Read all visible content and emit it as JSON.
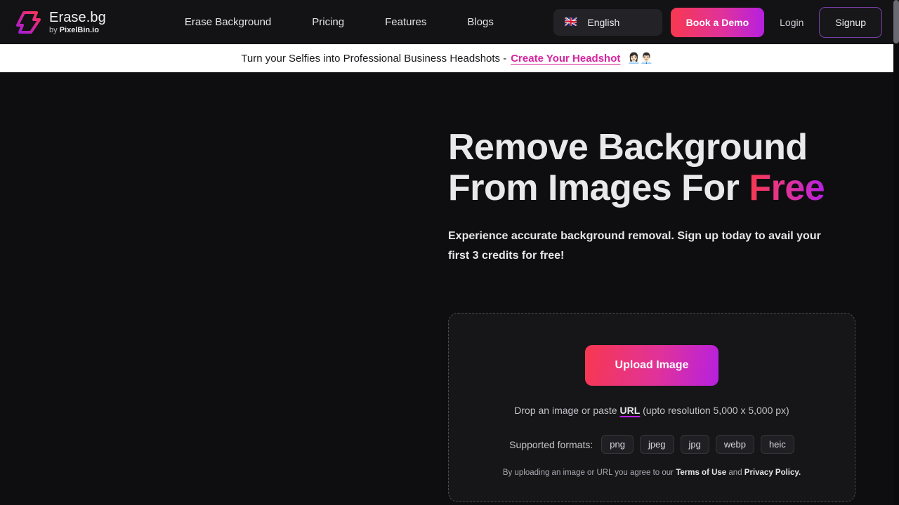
{
  "header": {
    "brand": {
      "name": "Erase.bg",
      "by_prefix": "by ",
      "by_name": "PixelBin.io",
      "logo_icon": "diamond-logo-icon"
    },
    "nav": [
      {
        "label": "Erase Background"
      },
      {
        "label": "Pricing"
      },
      {
        "label": "Features"
      },
      {
        "label": "Blogs"
      }
    ],
    "language": {
      "flag_icon": "uk-flag-icon",
      "flag_glyph": "🇬🇧",
      "label": "English"
    },
    "demo_button": "Book a Demo",
    "login_button": "Login",
    "signup_button": "Signup"
  },
  "banner": {
    "text": "Turn your Selfies into Professional Business Headshots -",
    "link": "Create Your Headshot",
    "emoji": "👩🏻‍💼👨🏻‍💼"
  },
  "hero": {
    "title_line1": "Remove Background",
    "title_line2_plain": "From Images For ",
    "title_line2_accent": "Free",
    "subtitle": "Experience accurate background removal. Sign up today to avail your first 3 credits for free!"
  },
  "upload": {
    "button_label": "Upload Image",
    "drop_prefix": "Drop an image or paste ",
    "drop_url": "URL",
    "drop_suffix": " (upto resolution 5,000 x 5,000 px)",
    "formats_label": "Supported formats:",
    "formats": [
      "png",
      "jpeg",
      "jpg",
      "webp",
      "heic"
    ],
    "terms_prefix": "By uploading an image or URL you agree to our ",
    "terms_link1": "Terms of Use",
    "terms_middle": " and ",
    "terms_link2": "Privacy Policy."
  },
  "colors": {
    "page_bg": "#0e0e10",
    "header_bg": "#131316",
    "banner_bg": "#ffffff",
    "gradient_start": "#f8384f",
    "gradient_mid": "#e0329a",
    "gradient_end": "#b620e0",
    "banner_link": "#d6249f",
    "signup_border": "#7b3fa8"
  }
}
